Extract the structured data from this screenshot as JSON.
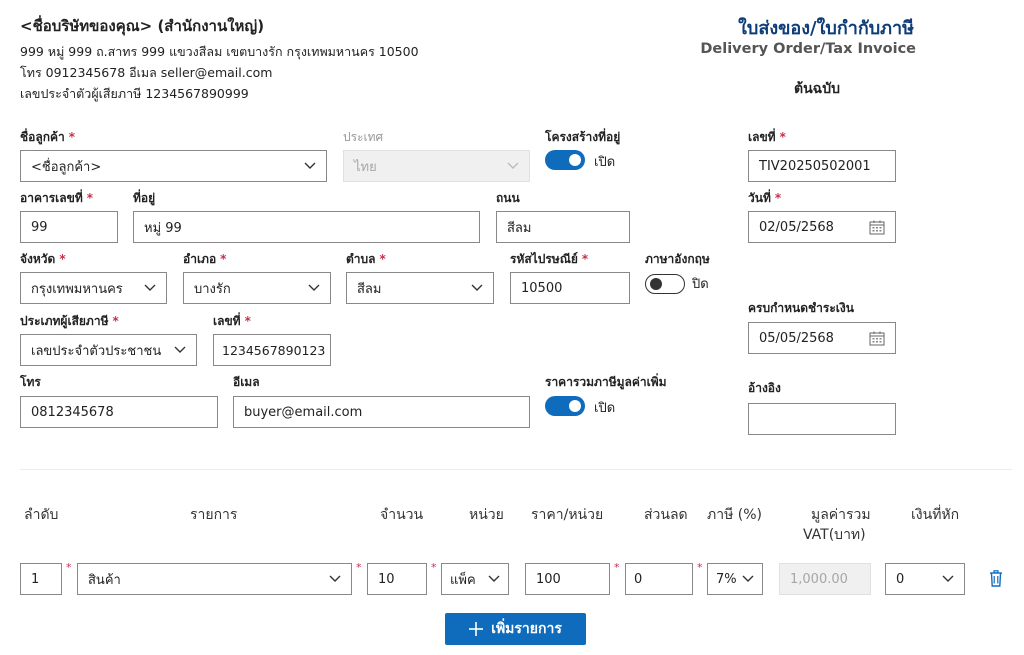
{
  "seller": {
    "name": "<ชื่อบริษัทของคุณ> (สำนักงานใหญ่)",
    "address": "999 หมู่ 999 ถ.สาทร 999 แขวงสีลม เขตบางรัก กรุงเทพมหานคร 10500",
    "contact": "โทร 0912345678 อีเมล seller@email.com",
    "tax_id": "เลขประจำตัวผู้เสียภาษี 1234567890999"
  },
  "doc": {
    "title_th": "ใบส่งของ/ใบกำกับภาษี",
    "title_en": "Delivery Order/Tax Invoice",
    "copy": "ต้นฉบับ"
  },
  "form": {
    "customer_label": "ชื่อลูกค้า",
    "customer_value": "<ชื่อลูกค้า>",
    "country_label": "ประเทศ",
    "country_value": "ไทย",
    "struct_label": "โครงสร้างที่อยู่",
    "struct_state": "เปิด",
    "building_label": "อาคารเลขที่",
    "building_value": "99",
    "address_label": "ที่อยู่",
    "address_value": "หมู่ 99",
    "road_label": "ถนน",
    "road_value": "สีลม",
    "province_label": "จังหวัด",
    "province_value": "กรุงเทพมหานคร",
    "district_label": "อำเภอ",
    "district_value": "บางรัก",
    "subdistrict_label": "ตำบล",
    "subdistrict_value": "สีลม",
    "postal_label": "รหัสไปรษณีย์",
    "postal_value": "10500",
    "english_label": "ภาษาอังกฤษ",
    "english_state": "ปิด",
    "taxpayer_type_label": "ประเภทผู้เสียภาษี",
    "taxpayer_type_value": "เลขประจำตัวประชาชน",
    "taxid_label": "เลขที่",
    "taxid_value": "1234567890123",
    "phone_label": "โทร",
    "phone_value": "0812345678",
    "email_label": "อีเมล",
    "email_value": "buyer@email.com",
    "vat_incl_label": "ราคารวมภาษีมูลค่าเพิ่ม",
    "vat_incl_state": "เปิด",
    "docno_label": "เลขที่",
    "docno_value": "TIV20250502001",
    "date_label": "วันที่",
    "date_value": "02/05/2568",
    "due_label": "ครบกำหนดชำระเงิน",
    "due_value": "05/05/2568",
    "ref_label": "อ้างอิง",
    "ref_value": ""
  },
  "table": {
    "headers": {
      "no": "ลำดับ",
      "item": "รายการ",
      "qty": "จำนวน",
      "unit": "หน่วย",
      "price": "ราคา/หน่วย",
      "discount": "ส่วนลด",
      "tax": "ภาษี (%)",
      "vat_total_1": "มูลค่ารวม",
      "vat_total_2": "VAT(บาท)",
      "withholding": "เงินที่หัก"
    },
    "row": {
      "no": "1",
      "item": "สินค้า",
      "qty": "10",
      "unit": "แพ็ค",
      "price": "100",
      "discount": "0",
      "tax": "7%",
      "vat_total": "1,000.00",
      "withholding": "0"
    }
  },
  "actions": {
    "add_item": "เพิ่มรายการ"
  },
  "icons": {
    "calendar": "calendar-icon",
    "trash": "trash-icon",
    "chevron": "chevron-down-icon",
    "plus": "plus-icon"
  },
  "colors": {
    "accent": "#0f6cbd",
    "title": "#0f3d7a",
    "required": "#c4314b"
  }
}
